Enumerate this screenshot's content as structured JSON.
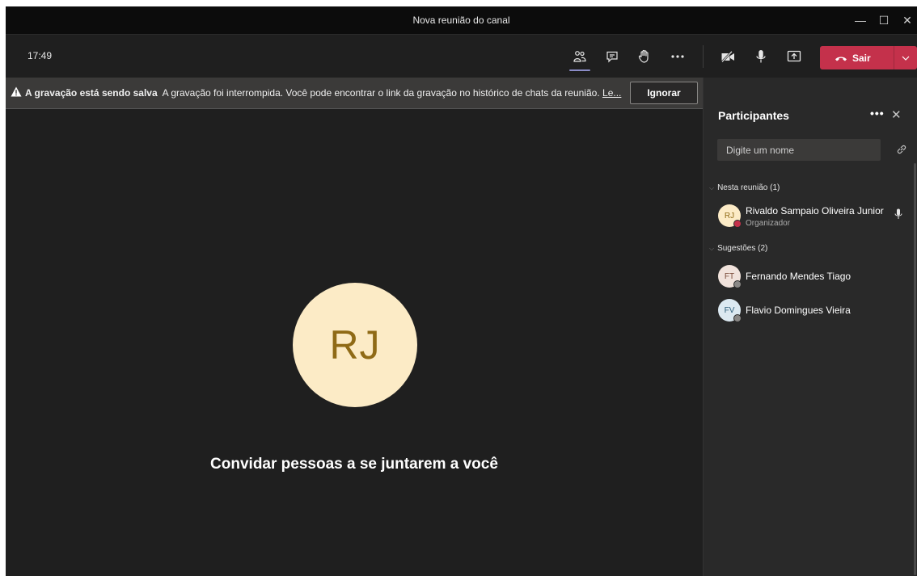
{
  "window": {
    "title": "Nova reunião do canal",
    "minimize_glyph": "—",
    "maximize_glyph": "☐",
    "close_glyph": "✕"
  },
  "toolbar": {
    "time": "17:49",
    "icons": [
      "participants-icon",
      "chat-icon",
      "raise-hand-icon",
      "more-options-icon",
      "camera-off-icon",
      "microphone-icon",
      "share-screen-icon"
    ],
    "leave_label": "Sair",
    "leave_color": "#c4314b"
  },
  "banner": {
    "title": "A gravação está sendo salva",
    "message": "A gravação foi interrompida. Você pode encontrar o link da gravação no histórico de chats da reunião.",
    "link_text": "Le...",
    "dismiss_label": "Ignorar"
  },
  "annotation": {
    "arrow_color": "#ffff00"
  },
  "stage": {
    "avatar_initials": "RJ",
    "avatar_bg": "#fcebc6",
    "avatar_fg": "#8f6a16",
    "invite_text": "Convidar pessoas a se juntarem a você"
  },
  "participants": {
    "title": "Participantes",
    "more_glyph": "•••",
    "close_glyph": "✕",
    "search_placeholder": "Digite um nome",
    "in_meeting_label": "Nesta reunião (1)",
    "in_meeting": [
      {
        "initials": "RJ",
        "name": "Rivaldo Sampaio Oliveira Junior",
        "role": "Organizador",
        "avatar_bg": "#fcebc6",
        "avatar_fg": "#8f6a16",
        "status_color": "#c4314b"
      }
    ],
    "suggestions_label": "Sugestões (2)",
    "suggestions": [
      {
        "initials": "FT",
        "name": "Fernando Mendes Tiago",
        "avatar_bg": "#f1e3dc",
        "avatar_fg": "#7a4c3a",
        "status_color": "#8a8886"
      },
      {
        "initials": "FV",
        "name": "Flavio Domingues Vieira",
        "avatar_bg": "#dce9f1",
        "avatar_fg": "#2e5e7a",
        "status_color": "#8a8886"
      }
    ]
  }
}
